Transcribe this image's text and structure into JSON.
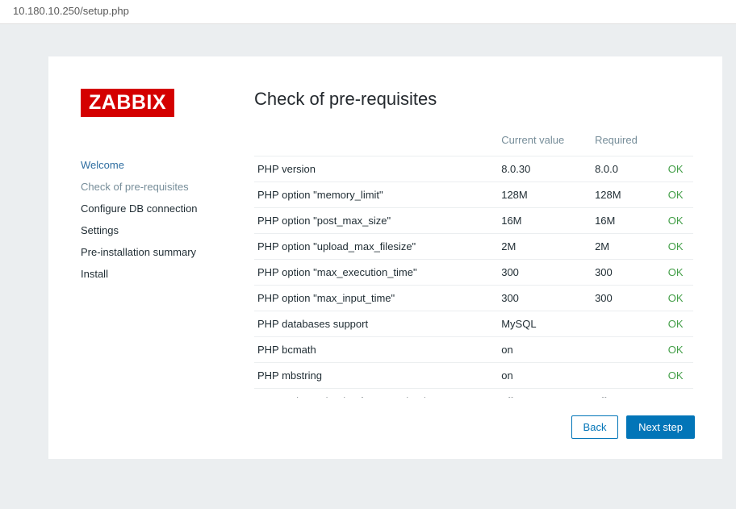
{
  "url": "10.180.10.250/setup.php",
  "logo_text": "ZABBIX",
  "title": "Check of pre-requisites",
  "nav": {
    "items": [
      {
        "label": "Welcome",
        "state": "done"
      },
      {
        "label": "Check of pre-requisites",
        "state": "current"
      },
      {
        "label": "Configure DB connection",
        "state": ""
      },
      {
        "label": "Settings",
        "state": ""
      },
      {
        "label": "Pre-installation summary",
        "state": ""
      },
      {
        "label": "Install",
        "state": ""
      }
    ]
  },
  "table": {
    "headers": {
      "current": "Current value",
      "required": "Required"
    },
    "rows": [
      {
        "name": "PHP version",
        "current": "8.0.30",
        "required": "8.0.0",
        "status": "OK"
      },
      {
        "name": "PHP option \"memory_limit\"",
        "current": "128M",
        "required": "128M",
        "status": "OK"
      },
      {
        "name": "PHP option \"post_max_size\"",
        "current": "16M",
        "required": "16M",
        "status": "OK"
      },
      {
        "name": "PHP option \"upload_max_filesize\"",
        "current": "2M",
        "required": "2M",
        "status": "OK"
      },
      {
        "name": "PHP option \"max_execution_time\"",
        "current": "300",
        "required": "300",
        "status": "OK"
      },
      {
        "name": "PHP option \"max_input_time\"",
        "current": "300",
        "required": "300",
        "status": "OK"
      },
      {
        "name": "PHP databases support",
        "current": "MySQL",
        "required": "",
        "status": "OK"
      },
      {
        "name": "PHP bcmath",
        "current": "on",
        "required": "",
        "status": "OK"
      },
      {
        "name": "PHP mbstring",
        "current": "on",
        "required": "",
        "status": "OK"
      },
      {
        "name": "PHP option \"mbstring.func_overload\"",
        "current": "off",
        "required": "off",
        "status": "OK"
      }
    ]
  },
  "buttons": {
    "back": "Back",
    "next": "Next step"
  }
}
